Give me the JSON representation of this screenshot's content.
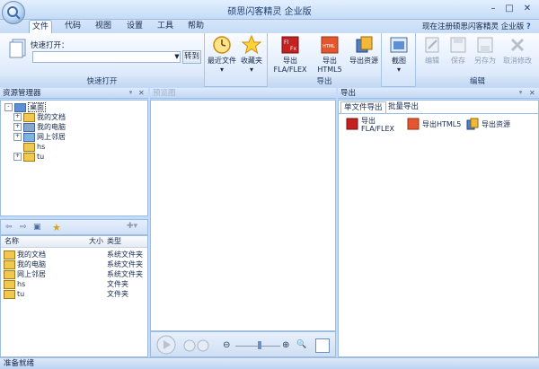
{
  "window": {
    "title": "硕思闪客精灵 企业版",
    "help_icon": "?"
  },
  "tabs": [
    "文件",
    "代码",
    "视图",
    "设置",
    "工具",
    "帮助"
  ],
  "registered_text": "现在注册硕思闪客精灵 企业版",
  "ribbon": {
    "quick_open": {
      "label": "快速打开：",
      "input_value": "",
      "go_label": "转到",
      "group_label": "快速打开"
    },
    "recent_label": "最近文件",
    "favorites_label": "收藏夹",
    "export_group": {
      "fla": "导出FLA/FLEX",
      "html5": "导出HTML5",
      "resources": "导出资源",
      "label": "导出"
    },
    "screenshot_group": {
      "capture": "截图"
    },
    "edit_group": {
      "edit": "编辑",
      "save": "保存",
      "save_as": "另存为",
      "cancel": "取消修改",
      "label": "编辑"
    }
  },
  "explorer": {
    "title": "资源管理器",
    "tree": [
      {
        "label": "桌面",
        "icon": "desktop-icon",
        "level": 0,
        "expander": "-"
      },
      {
        "label": "我的文档",
        "icon": "documents-folder-icon",
        "level": 1,
        "expander": "+"
      },
      {
        "label": "我的电脑",
        "icon": "computer-icon",
        "level": 1,
        "expander": "+"
      },
      {
        "label": "网上邻居",
        "icon": "network-icon",
        "level": 1,
        "expander": "+"
      },
      {
        "label": "hs",
        "icon": "folder-icon",
        "level": 1,
        "expander": ""
      },
      {
        "label": "tu",
        "icon": "folder-icon",
        "level": 1,
        "expander": "+"
      }
    ],
    "list_columns": [
      "名称",
      "大小",
      "类型"
    ],
    "list_rows": [
      {
        "name": "我的文档",
        "size": "",
        "type": "系统文件夹"
      },
      {
        "name": "我的电脑",
        "size": "",
        "type": "系统文件夹"
      },
      {
        "name": "网上邻居",
        "size": "",
        "type": "系统文件夹"
      },
      {
        "name": "hs",
        "size": "",
        "type": "文件夹"
      },
      {
        "name": "tu",
        "size": "",
        "type": "文件夹"
      }
    ]
  },
  "preview": {
    "title": "预览图"
  },
  "export_panel": {
    "title": "导出",
    "tabs": [
      "单文件导出",
      "批量导出"
    ],
    "buttons": {
      "fla_line1": "导出",
      "fla_line2": "FLA/FLEX",
      "html5": "导出HTML5",
      "resources": "导出资源"
    }
  },
  "status": {
    "text": "准备就绪"
  },
  "colors": {
    "accent": "#3d6db5",
    "panel_header": "#c1d7f3",
    "frame": "#bfdbff"
  }
}
